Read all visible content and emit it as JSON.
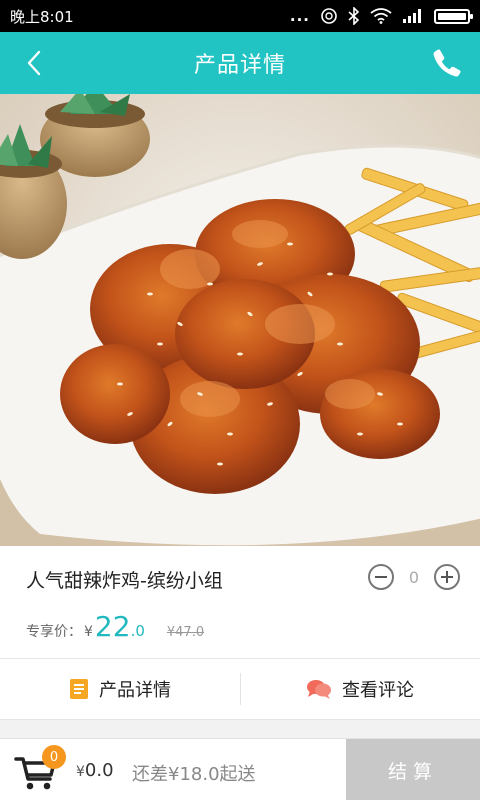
{
  "status_bar": {
    "time": "晚上8:01",
    "dots": "...",
    "icons": [
      "alarm-icon",
      "bluetooth-icon",
      "wifi-icon",
      "signal-icon",
      "battery-icon"
    ]
  },
  "header": {
    "title": "产品详情",
    "back_icon": "chevron-left-icon",
    "phone_icon": "phone-icon",
    "bg_color": "#22c3c3"
  },
  "hero_image": {
    "subject": "sweet-spicy-fried-chicken-photo"
  },
  "product": {
    "name": "人气甜辣炸鸡-缤纷小组",
    "quantity": "0",
    "price_label": "专享价：",
    "currency": "¥",
    "price_integer": "22",
    "price_decimal": ".0",
    "original_price": "¥47.0",
    "price_color": "#22b8c0"
  },
  "tabs": [
    {
      "label": "产品详情",
      "icon": "document-icon",
      "icon_color": "#f5a623"
    },
    {
      "label": "查看评论",
      "icon": "chat-bubbles-icon",
      "icon_color": "#f26a5a"
    }
  ],
  "cart": {
    "badge_count": "0",
    "currency": "¥",
    "total": "0.0",
    "shortfall_text": "还差¥18.0起送",
    "checkout_label": "结算",
    "badge_color": "#f5971e"
  }
}
